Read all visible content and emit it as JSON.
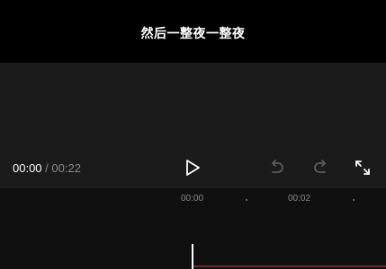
{
  "preview": {
    "subtitle": "然后一整夜一整夜"
  },
  "playback": {
    "current_time": "00:00",
    "separator": "/",
    "total_time": "00:22"
  },
  "controls": {
    "play_icon": "play-icon",
    "undo_icon": "undo-icon",
    "redo_icon": "redo-icon",
    "fullscreen_icon": "fullscreen-icon"
  },
  "timeline": {
    "ruler_labels": [
      "00:00",
      "00:02"
    ]
  },
  "colors": {
    "background": "#121212",
    "preview_background": "#000000",
    "text_primary": "#ffffff",
    "text_muted": "#8a8a8a",
    "disabled_icon": "#5c5c5c",
    "clip_track": "#6b2626"
  }
}
